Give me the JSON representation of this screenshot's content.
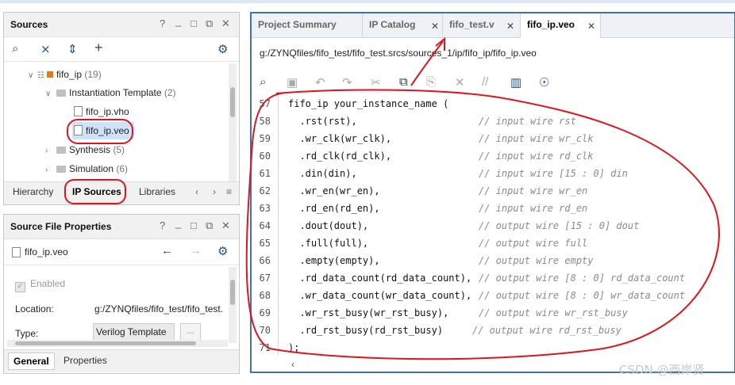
{
  "sources": {
    "title": "Sources",
    "controls": [
      "?",
      "_",
      "□",
      "⧉",
      "✕"
    ],
    "tree": [
      {
        "label": "fifo_ip",
        "count": "(19)"
      },
      {
        "label": "Instantiation Template",
        "count": "(2)"
      },
      {
        "label": "fifo_ip.vho",
        "count": ""
      },
      {
        "label": "fifo_ip.veo",
        "count": ""
      },
      {
        "label": "Synthesis",
        "count": "(5)"
      },
      {
        "label": "Simulation",
        "count": "(6)"
      }
    ],
    "tabs": [
      "Hierarchy",
      "IP Sources",
      "Libraries"
    ]
  },
  "props": {
    "title": "Source File Properties",
    "controls": [
      "?",
      "_",
      "□",
      "⧉",
      "✕"
    ],
    "file_name": "fifo_ip.veo",
    "enabled_label": "Enabled",
    "location_label": "Location:",
    "location_value": "g:/ZYNQfiles/fifo_test/fifo_test.",
    "type_label": "Type:",
    "type_value": "Verilog Template",
    "more_button": "...",
    "tabs": [
      "General",
      "Properties"
    ]
  },
  "editor": {
    "tabs": [
      {
        "label": "Project Summary",
        "close": "✕"
      },
      {
        "label": "IP Catalog",
        "close": "✕"
      },
      {
        "label": "fifo_test.v",
        "close": "✕"
      },
      {
        "label": "fifo_ip.veo",
        "close": "✕"
      }
    ],
    "path": "g:/ZYNQfiles/fifo_test/fifo_test.srcs/sources_1/ip/fifo_ip/fifo_ip.veo",
    "lines": [
      {
        "num": "57",
        "code": "fifo_ip your_instance_name (",
        "comment": ""
      },
      {
        "num": "58",
        "code": "  .rst(rst),",
        "comment": "// input wire rst"
      },
      {
        "num": "59",
        "code": "  .wr_clk(wr_clk),",
        "comment": "// input wire wr_clk"
      },
      {
        "num": "60",
        "code": "  .rd_clk(rd_clk),",
        "comment": "// input wire rd_clk"
      },
      {
        "num": "61",
        "code": "  .din(din),",
        "comment": "// input wire [15 : 0] din"
      },
      {
        "num": "62",
        "code": "  .wr_en(wr_en),",
        "comment": "// input wire wr_en"
      },
      {
        "num": "63",
        "code": "  .rd_en(rd_en),",
        "comment": "// input wire rd_en"
      },
      {
        "num": "64",
        "code": "  .dout(dout),",
        "comment": "// output wire [15 : 0] dout"
      },
      {
        "num": "65",
        "code": "  .full(full),",
        "comment": "// output wire full"
      },
      {
        "num": "66",
        "code": "  .empty(empty),",
        "comment": "// output wire empty"
      },
      {
        "num": "67",
        "code": "  .rd_data_count(rd_data_count),",
        "comment": "// output wire [8 : 0] rd_data_count"
      },
      {
        "num": "68",
        "code": "  .wr_data_count(wr_data_count),",
        "comment": "// output wire [8 : 0] wr_data_count"
      },
      {
        "num": "69",
        "code": "  .wr_rst_busy(wr_rst_busy),",
        "comment": "// output wire wr_rst_busy"
      },
      {
        "num": "70",
        "code": "  .rd_rst_busy(rd_rst_busy)",
        "comment": "// output wire rd_rst_busy"
      },
      {
        "num": "71",
        "code": ");",
        "comment": ""
      }
    ]
  },
  "watermark": "CSDN @西岸贤",
  "colors": {
    "annotation_red": "#e0141c",
    "selection": "#cfe2fb",
    "active_border": "#3a73b8"
  }
}
